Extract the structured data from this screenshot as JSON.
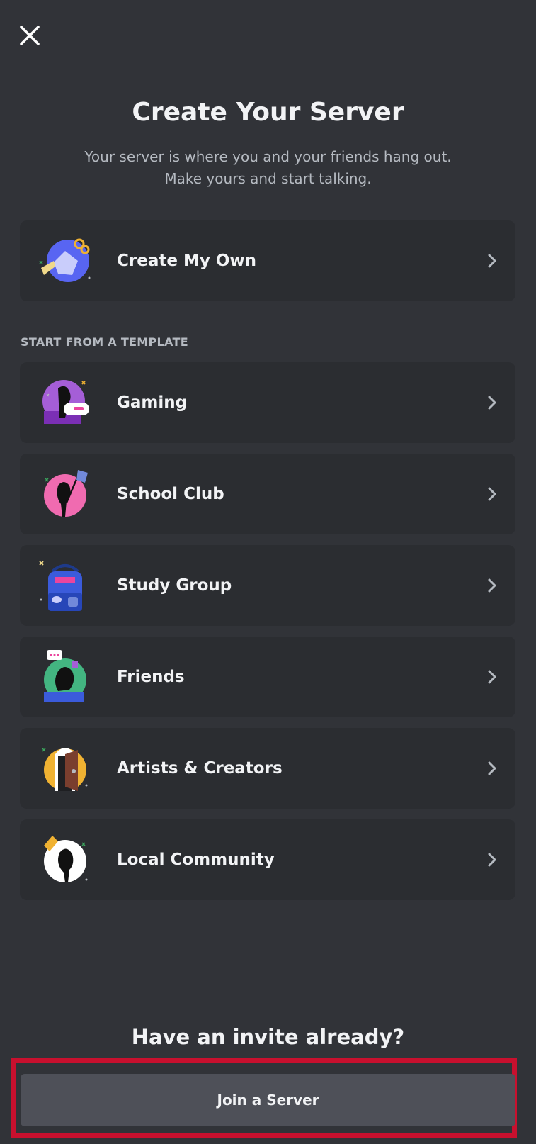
{
  "modal": {
    "title": "Create Your Server",
    "subtitle_line1": "Your server is where you and your friends hang out.",
    "subtitle_line2": "Make yours and start talking."
  },
  "create_own": {
    "label": "Create My Own",
    "icon": "globe-with-wrench-illustration"
  },
  "template_section": {
    "header": "START FROM A TEMPLATE",
    "items": [
      {
        "label": "Gaming",
        "icon": "gaming-illustration"
      },
      {
        "label": "School Club",
        "icon": "school-club-illustration"
      },
      {
        "label": "Study Group",
        "icon": "study-group-backpack-illustration"
      },
      {
        "label": "Friends",
        "icon": "friends-illustration"
      },
      {
        "label": "Artists & Creators",
        "icon": "artists-door-illustration"
      },
      {
        "label": "Local Community",
        "icon": "local-community-illustration"
      }
    ]
  },
  "invite": {
    "heading": "Have an invite already?",
    "join_label": "Join a Server"
  },
  "colors": {
    "background": "#313338",
    "card": "#2b2d31",
    "button": "#4e5058",
    "highlight_outline": "#c8102e"
  }
}
